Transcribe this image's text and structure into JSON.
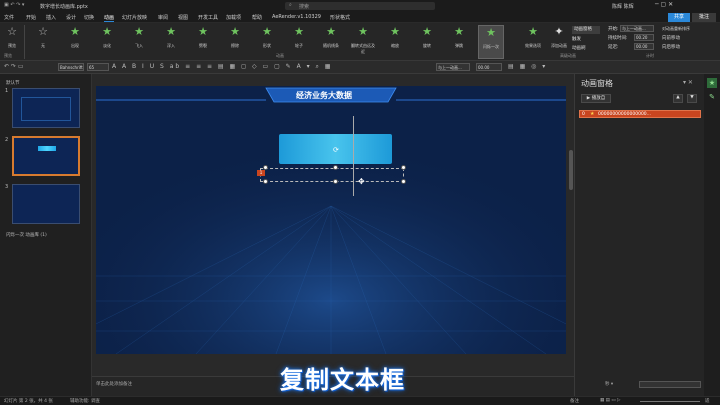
{
  "title_bar": {
    "file_name": "数字增长动画库.pptx",
    "search_placeholder": "搜索",
    "user": "陈辉 陈辉"
  },
  "menu": {
    "items": [
      "文件",
      "开始",
      "插入",
      "设计",
      "切换",
      "动画",
      "幻灯片放映",
      "审阅",
      "视图",
      "开发工具",
      "加载项",
      "帮助",
      "AeRender.v1.10329",
      "形状格式"
    ],
    "active": "动画",
    "share": "共享",
    "comment": "批注"
  },
  "ribbon": {
    "preview_label": "预览",
    "effects": [
      "无",
      "出现",
      "淡化",
      "飞入",
      "浮入",
      "劈裂",
      "擦除",
      "形状",
      "轮子",
      "随机线条",
      "翻转式由远及近",
      "缩放",
      "旋转",
      "弹跳",
      "闪烁一次"
    ],
    "selected_effect": "闪烁一次",
    "effect_options": "效果选项",
    "add_animation": "添加动画",
    "group_preview": "预览",
    "group_animation": "动画",
    "group_advanced": "高级动画",
    "group_timing": "计时",
    "anim_pane_btn": "动画窗格",
    "trigger": "触发",
    "anim_painter": "动画刷",
    "start_label": "开始:",
    "start_value": "与上一动画...",
    "duration_label": "持续时间:",
    "duration_value": "00.20",
    "delay_label": "延迟:",
    "delay_value": "00.00",
    "reorder_label": "对动画重新排序",
    "move_earlier": "向前移动",
    "move_later": "向后移动"
  },
  "toolbar2": {
    "font": "Bahnschrift",
    "size": "65",
    "align_label": "与上一动画...",
    "timing": "00.00"
  },
  "thumbnails": {
    "section_default": "默认节",
    "section_anim": "闪烁一次 动画库 (1)",
    "numbers": [
      "1",
      "2",
      "3"
    ]
  },
  "slide": {
    "header_title": "经济业务大数据",
    "text_box_label": "1"
  },
  "notes": {
    "placeholder": "单击此处添加备注"
  },
  "anim_pane": {
    "title": "动画窗格",
    "play_button": "播放自",
    "item_index": "0",
    "item_text": "00000000000000000..."
  },
  "caption": "复制文本框",
  "status": {
    "slide_info": "幻灯片 第 2 张，共 4 张",
    "accessibility": "辅助功能: 调查",
    "notes_btn": "备注",
    "zoom_text": "适"
  },
  "colors": {
    "accent": "#2b88d8",
    "selection": "#d77b2f",
    "anim_item_bg": "#c9451f",
    "slide_bg": "#0c2148"
  }
}
